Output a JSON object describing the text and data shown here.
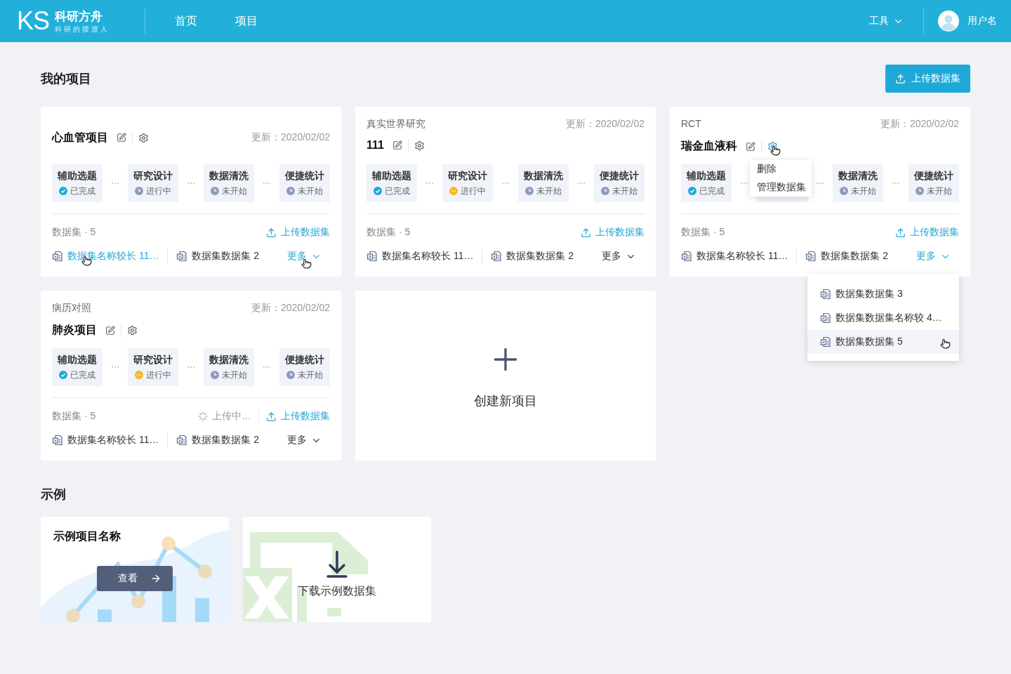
{
  "header": {
    "logo_mark": "KS",
    "brand": "科研方舟",
    "slogan": "科研的摆渡人",
    "nav": [
      {
        "label": "首页"
      },
      {
        "label": "项目"
      }
    ],
    "tools": "工具",
    "user": "用户名"
  },
  "my_projects": {
    "title": "我的项目",
    "upload_button": "上传数据集"
  },
  "projects": [
    {
      "name": "心血管项目",
      "updated": "更新：2020/02/02",
      "settings_open": false,
      "stages": [
        {
          "kind": "stage",
          "name": "辅助选题",
          "status": {
            "kind": "done",
            "label": "已完成"
          }
        },
        {
          "kind": "stage",
          "name": "研究设计",
          "status": {
            "kind": "pending",
            "label": "进行中"
          }
        },
        {
          "kind": "stage",
          "name": "数据清洗",
          "status": {
            "kind": "pending",
            "label": "未开始"
          }
        },
        {
          "kind": "stage",
          "name": "便捷统计",
          "status": {
            "kind": "pending",
            "label": "未开始"
          }
        }
      ],
      "dataset_count": "数据集 · 5",
      "upload_link": "上传数据集",
      "datasets": [
        {
          "name": "数据集名称较长 11…",
          "hovered": true
        },
        {
          "name": "数据集数据集 2",
          "hovered": false
        }
      ],
      "more": {
        "label": "更多",
        "hovered": true,
        "open": false
      }
    },
    {
      "category": "真实世界研究",
      "name": "111",
      "updated": "更新：2020/02/02",
      "settings_open": false,
      "stages": [
        {
          "kind": "stage",
          "name": "辅助选题",
          "status": {
            "kind": "done",
            "label": "已完成"
          }
        },
        {
          "kind": "stage",
          "name": "研究设计",
          "status": {
            "kind": "progress",
            "label": "进行中"
          }
        },
        {
          "kind": "stage",
          "name": "数据清洗",
          "status": {
            "kind": "pending",
            "label": "未开始"
          }
        },
        {
          "kind": "stage",
          "name": "便捷统计",
          "status": {
            "kind": "pending",
            "label": "未开始"
          }
        }
      ],
      "dataset_count": "数据集 · 5",
      "upload_link": "上传数据集",
      "datasets": [
        {
          "name": "数据集名称较长 11…",
          "hovered": false
        },
        {
          "name": "数据集数据集 2",
          "hovered": false
        }
      ],
      "more": {
        "label": "更多",
        "hovered": false,
        "open": false
      }
    },
    {
      "category": "RCT",
      "name": "瑞金血液科",
      "updated": "更新：2020/02/02",
      "settings_open": true,
      "settings_menu": [
        "删除",
        "管理数据集"
      ],
      "stages": [
        {
          "kind": "stage",
          "name": "辅助选题",
          "status": {
            "kind": "done",
            "label": "已完成"
          }
        },
        {
          "kind": "covered"
        },
        {
          "kind": "stage",
          "name": "数据清洗",
          "status": {
            "kind": "pending",
            "label": "未开始"
          }
        },
        {
          "kind": "stage",
          "name": "便捷统计",
          "status": {
            "kind": "pending",
            "label": "未开始"
          }
        }
      ],
      "dataset_count": "数据集 · 5",
      "upload_link": "上传数据集",
      "datasets": [
        {
          "name": "数据集名称较长 11…",
          "hovered": false
        },
        {
          "name": "数据集数据集 2",
          "hovered": false
        }
      ],
      "more": {
        "label": "更多",
        "hovered": false,
        "open": true,
        "items": [
          {
            "name": "数据集数据集 3",
            "hovered": false
          },
          {
            "name": "数据集数据集名称较 4…",
            "hovered": false
          },
          {
            "name": "数据集数据集 5",
            "hovered": true
          }
        ]
      }
    },
    {
      "category": "病历对照",
      "name": "肺炎项目",
      "updated": "更新：2020/02/02",
      "settings_open": false,
      "stages": [
        {
          "kind": "stage",
          "name": "辅助选题",
          "status": {
            "kind": "done",
            "label": "已完成"
          }
        },
        {
          "kind": "stage",
          "name": "研究设计",
          "status": {
            "kind": "progress",
            "label": "进行中"
          }
        },
        {
          "kind": "stage",
          "name": "数据清洗",
          "status": {
            "kind": "pending",
            "label": "未开始"
          }
        },
        {
          "kind": "stage",
          "name": "便捷统计",
          "status": {
            "kind": "pending",
            "label": "未开始"
          }
        }
      ],
      "dataset_count": "数据集 · 5",
      "uploading": "上传中…",
      "upload_link": "上传数据集",
      "datasets": [
        {
          "name": "数据集名称较长 11…",
          "hovered": false
        },
        {
          "name": "数据集数据集 2",
          "hovered": false
        }
      ],
      "more": {
        "label": "更多",
        "hovered": false,
        "open": false
      }
    }
  ],
  "create_project": "创建新项目",
  "examples": {
    "title": "示例",
    "project": {
      "name": "示例项目名称",
      "view_button": "查看"
    },
    "download": "下载示例数据集"
  }
}
